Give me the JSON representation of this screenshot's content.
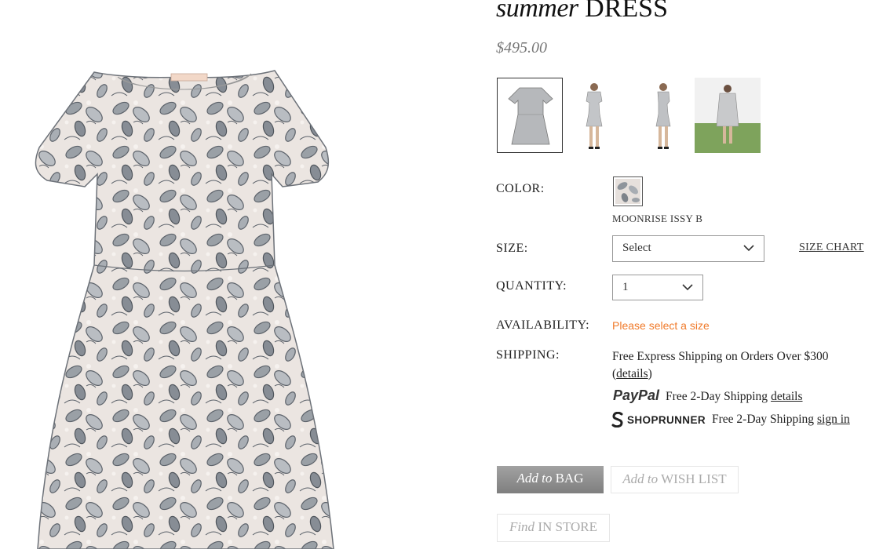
{
  "product": {
    "title_script": "summer",
    "title_caps": "DRESS",
    "price": "$495.00"
  },
  "gallery": {
    "main_image_icon": "floral-dress-image",
    "thumbnails": [
      {
        "icon": "dress-flat-thumbnail"
      },
      {
        "icon": "model-front-thumbnail"
      },
      {
        "icon": "model-side-thumbnail"
      },
      {
        "icon": "model-outdoor-thumbnail"
      }
    ]
  },
  "options": {
    "color_label": "COLOR:",
    "color_name": "MOONRISE ISSY B",
    "size_label": "SIZE:",
    "size_value": "Select",
    "size_chart_link": "SIZE CHART",
    "quantity_label": "QUANTITY:",
    "quantity_value": "1",
    "availability_label": "AVAILABILITY:",
    "availability_message": "Please select a size",
    "shipping_label": "SHIPPING:",
    "shipping_text": "Free Express Shipping on Orders Over $300",
    "shipping_details_link": "details",
    "paypal_logo": "PayPal",
    "paypal_text": "Free 2-Day Shipping",
    "paypal_link": "details",
    "shoprunner_logo": "SHOPRUNNER",
    "shoprunner_text": "Free 2-Day Shipping",
    "shoprunner_link": "sign in"
  },
  "actions": {
    "add_to_bag_italic": "Add to",
    "add_to_bag_caps": "BAG",
    "wishlist_italic": "Add to",
    "wishlist_caps": "WISH LIST",
    "find_store_italic": "Find",
    "find_store_caps": "IN STORE"
  },
  "colors": {
    "availability": "#f07a2a",
    "button_bag": "#8f8f8f",
    "text": "#222222"
  }
}
